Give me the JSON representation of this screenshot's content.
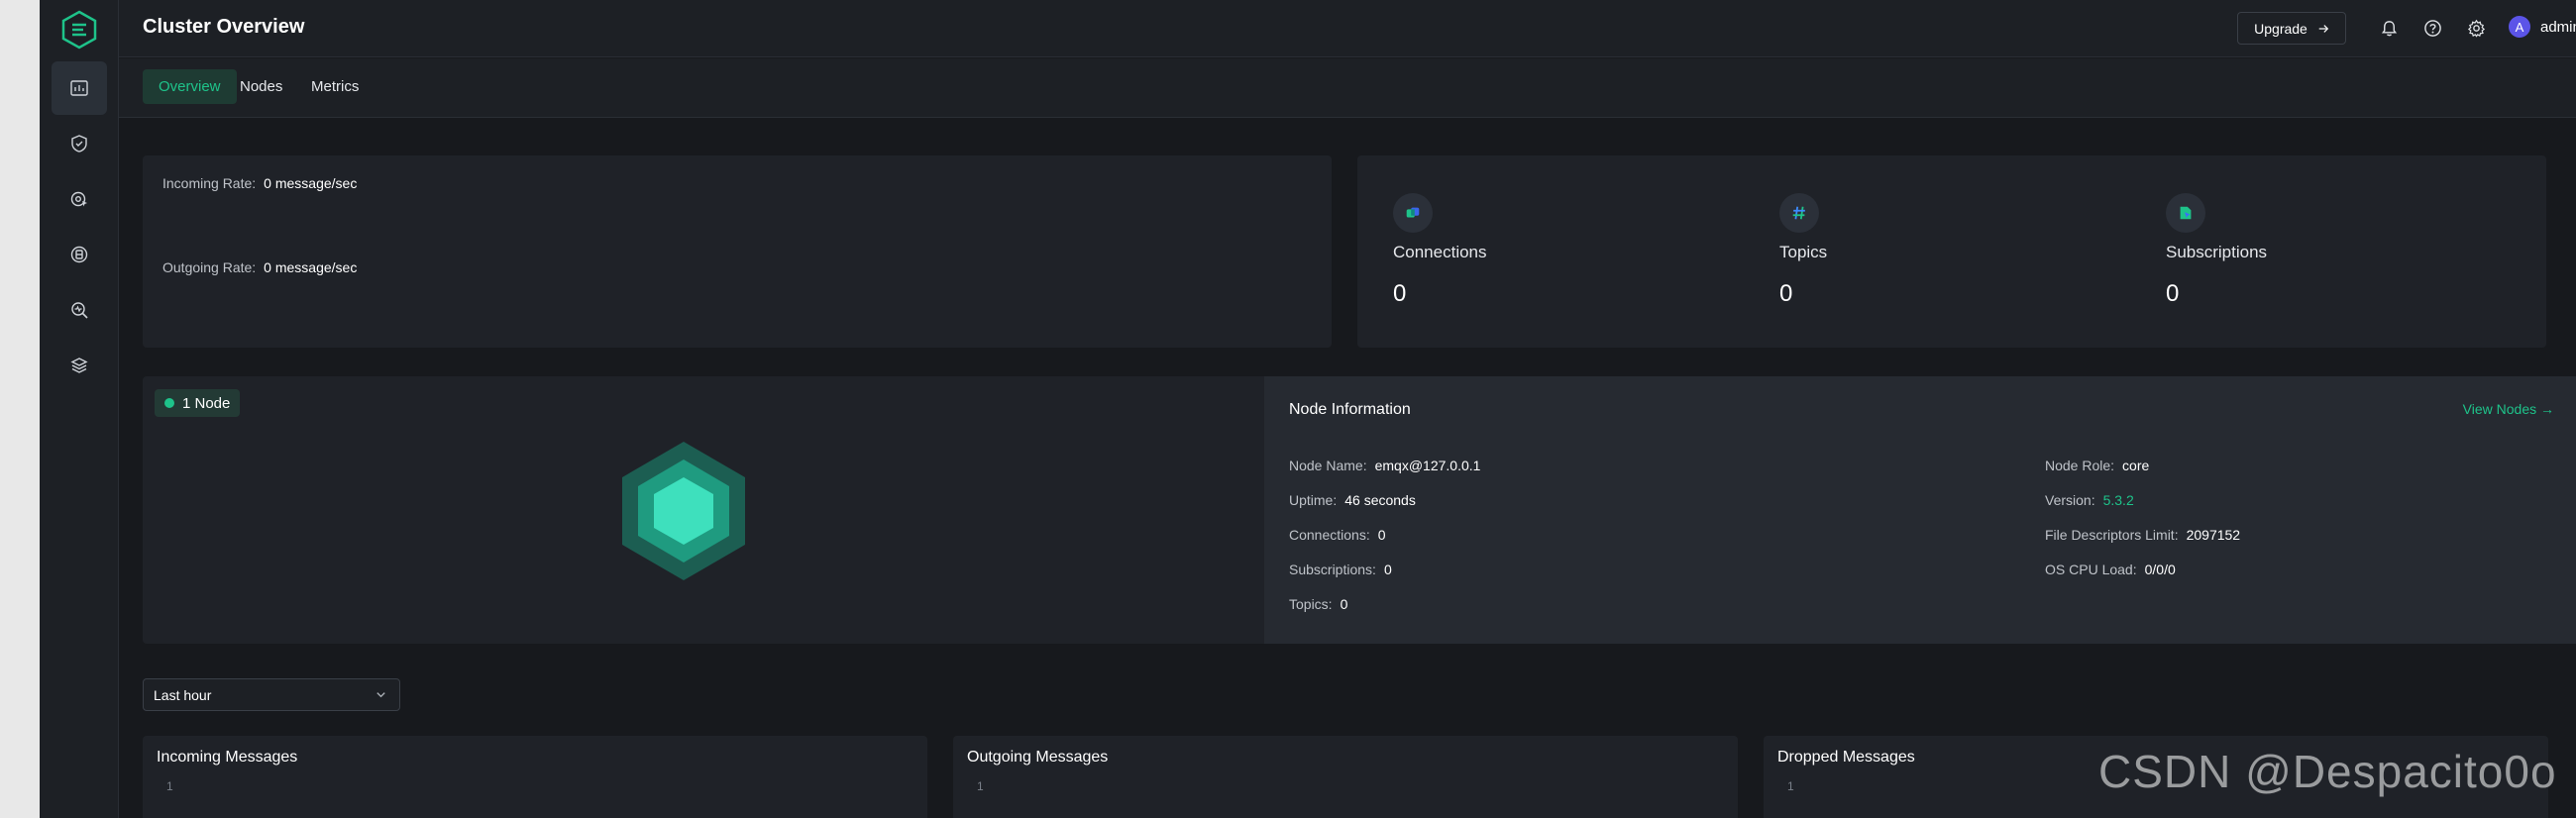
{
  "header": {
    "title": "Cluster Overview",
    "upgrade_label": "Upgrade",
    "user_initial": "A",
    "user_name": "admin"
  },
  "sidebar": {
    "items": [
      {
        "icon": "dashboard-icon",
        "active": true
      },
      {
        "icon": "shield-check-icon",
        "active": false
      },
      {
        "icon": "gear-cursor-icon",
        "active": false
      },
      {
        "icon": "integration-icon",
        "active": false
      },
      {
        "icon": "diagnose-search-icon",
        "active": false
      },
      {
        "icon": "layers-icon",
        "active": false
      }
    ]
  },
  "tabs": [
    {
      "label": "Overview",
      "active": true
    },
    {
      "label": "Nodes",
      "active": false
    },
    {
      "label": "Metrics",
      "active": false
    }
  ],
  "rates": {
    "incoming_label": "Incoming Rate:",
    "incoming_value": "0 message/sec",
    "outgoing_label": "Outgoing Rate:",
    "outgoing_value": "0 message/sec"
  },
  "stats": [
    {
      "label": "Connections",
      "value": "0",
      "icon": "connections-icon"
    },
    {
      "label": "Topics",
      "value": "0",
      "icon": "hash-icon"
    },
    {
      "label": "Subscriptions",
      "value": "0",
      "icon": "subscription-icon"
    }
  ],
  "node_badge": "1 Node",
  "node_info": {
    "title": "Node Information",
    "view_nodes": "View Nodes",
    "left": [
      {
        "label": "Node Name:",
        "value": "emqx@127.0.0.1"
      },
      {
        "label": "Uptime:",
        "value": "46 seconds"
      },
      {
        "label": "Connections:",
        "value": "0"
      },
      {
        "label": "Subscriptions:",
        "value": "0"
      },
      {
        "label": "Topics:",
        "value": "0"
      }
    ],
    "right": [
      {
        "label": "Node Role:",
        "value": "core"
      },
      {
        "label": "Version:",
        "value": "5.3.2"
      },
      {
        "label": "File Descriptors Limit:",
        "value": "2097152"
      },
      {
        "label": "OS CPU Load:",
        "value": "0/0/0"
      }
    ]
  },
  "time_range": {
    "selected": "Last hour"
  },
  "charts": [
    {
      "title": "Incoming Messages",
      "tick": "1"
    },
    {
      "title": "Outgoing Messages",
      "tick": "1"
    },
    {
      "title": "Dropped Messages",
      "tick": "1"
    }
  ],
  "watermark": "CSDN @Despacito0o",
  "colors": {
    "accent": "#1ec38a",
    "background": "#17191d",
    "card": "#1f2228"
  }
}
